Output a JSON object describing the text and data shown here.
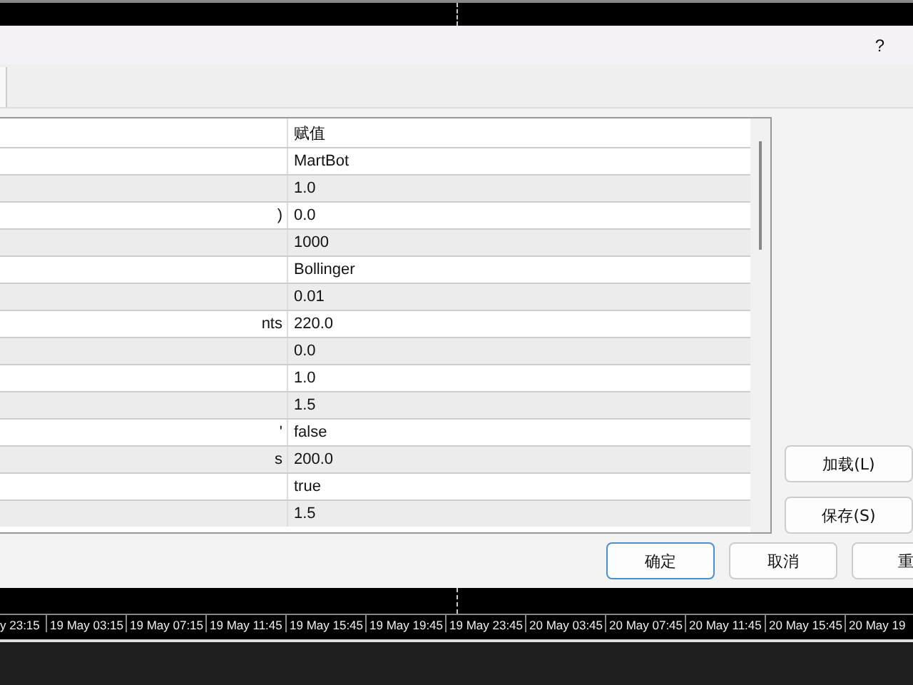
{
  "dialog": {
    "help": "?"
  },
  "table": {
    "columns": [
      "",
      "赋值"
    ],
    "rows": [
      {
        "name": "",
        "value": "MartBot"
      },
      {
        "name": "",
        "value": "1.0"
      },
      {
        "name": ")",
        "value": "0.0"
      },
      {
        "name": "",
        "value": "1000"
      },
      {
        "name": "",
        "value": "Bollinger"
      },
      {
        "name": "",
        "value": "0.01"
      },
      {
        "name": "nts",
        "value": "220.0"
      },
      {
        "name": "",
        "value": "0.0"
      },
      {
        "name": "",
        "value": "1.0"
      },
      {
        "name": "",
        "value": "1.5"
      },
      {
        "name": "'",
        "value": "false"
      },
      {
        "name": "s",
        "value": "200.0"
      },
      {
        "name": "",
        "value": "true"
      },
      {
        "name": "",
        "value": "1.5"
      }
    ]
  },
  "side_buttons": [
    "加载(L)",
    "保存(S)"
  ],
  "buttons": [
    {
      "label": "确定",
      "selected": true
    },
    {
      "label": "取消",
      "selected": false
    },
    {
      "label": "重",
      "selected": false
    }
  ],
  "time_axis": [
    "y 23:15",
    "19 May 03:15",
    "19 May 07:15",
    "19 May 11:45",
    "19 May 15:45",
    "19 May 19:45",
    "19 May 23:45",
    "20 May 03:45",
    "20 May 07:45",
    "20 May 11:45",
    "20 May 15:45",
    "20 May 19"
  ]
}
